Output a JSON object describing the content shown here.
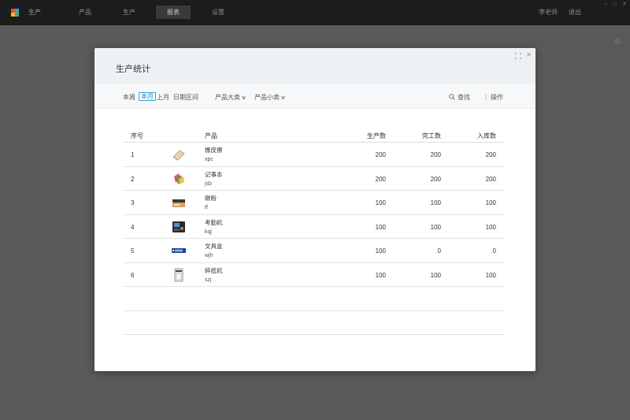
{
  "app": {
    "name": "生产"
  },
  "nav": [
    "产品",
    "生产",
    "报表",
    "设置"
  ],
  "nav_active_index": 2,
  "top_right": {
    "user": "李老师",
    "logout": "退出"
  },
  "modal": {
    "title": "生产统计",
    "filters": {
      "periods": [
        "本周",
        "本月",
        "上月",
        "日期区间"
      ],
      "active_period": "本月",
      "category_major": "产品大类",
      "category_minor": "产品小类",
      "search_label": "查找",
      "actions_label": "操作"
    },
    "table": {
      "headers": {
        "no": "序号",
        "product": "产品",
        "made": "生产数",
        "done": "完工数",
        "stock": "入库数"
      },
      "rows": [
        {
          "no": "1",
          "name": "橡皮擦",
          "code": "xpc",
          "made": "200",
          "done": "200",
          "stock": "200",
          "icon": "eraser-icon"
        },
        {
          "no": "2",
          "name": "记事本",
          "code": "jsb",
          "made": "200",
          "done": "200",
          "stock": "200",
          "icon": "notebook-icon"
        },
        {
          "no": "3",
          "name": "碳粉",
          "code": "tf",
          "made": "100",
          "done": "100",
          "stock": "100",
          "icon": "toner-icon"
        },
        {
          "no": "4",
          "name": "考勤机",
          "code": "kqj",
          "made": "100",
          "done": "100",
          "stock": "100",
          "icon": "attendance-machine-icon"
        },
        {
          "no": "5",
          "name": "文具盒",
          "code": "wjh",
          "made": "100",
          "done": "0",
          "stock": "0",
          "icon": "pencil-box-icon"
        },
        {
          "no": "6",
          "name": "碎纸机",
          "code": "szj",
          "made": "100",
          "done": "100",
          "stock": "100",
          "icon": "shredder-icon"
        }
      ]
    }
  },
  "colors": {
    "accent": "#3aa0d8",
    "topbar": "#1c1c1c",
    "overlay": "#5a5a5a"
  }
}
